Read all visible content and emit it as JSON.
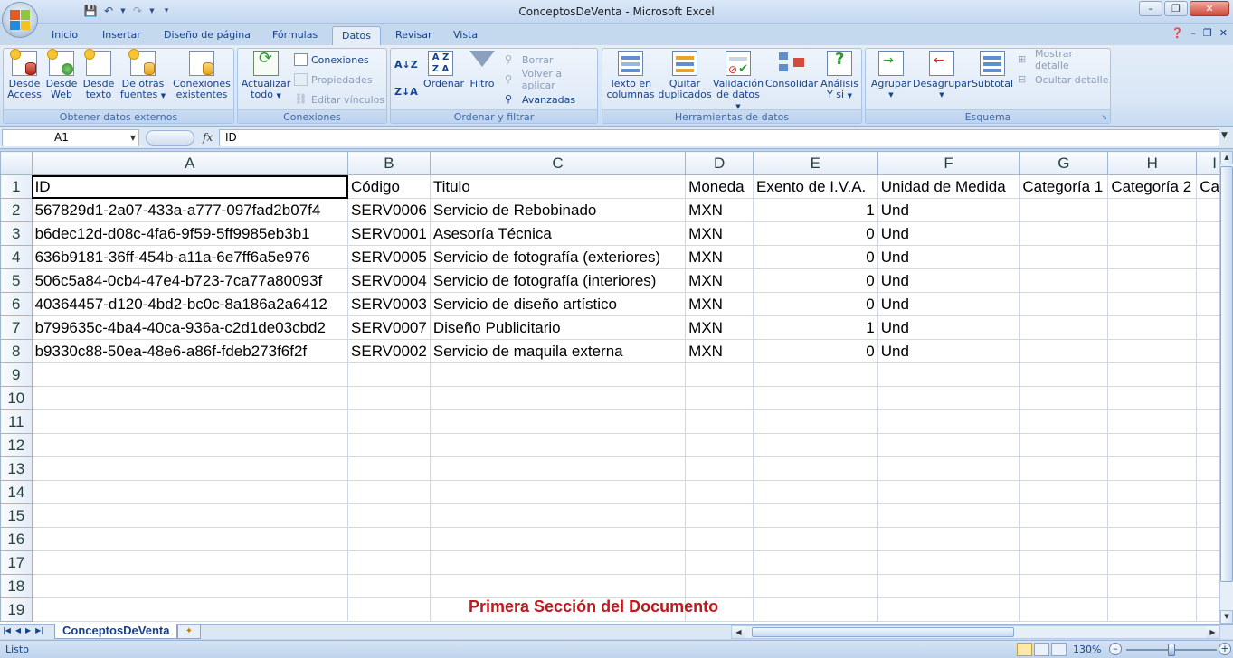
{
  "window": {
    "title": "ConceptosDeVenta - Microsoft Excel",
    "controls": [
      "minimize",
      "restore",
      "close"
    ]
  },
  "ribbon_tabs": [
    {
      "label": "Inicio",
      "active": false
    },
    {
      "label": "Insertar",
      "active": false
    },
    {
      "label": "Diseño de página",
      "active": false
    },
    {
      "label": "Fórmulas",
      "active": false
    },
    {
      "label": "Datos",
      "active": true
    },
    {
      "label": "Revisar",
      "active": false
    },
    {
      "label": "Vista",
      "active": false
    }
  ],
  "ribbon": {
    "obtener": {
      "label": "Obtener datos externos",
      "access": [
        "Desde",
        "Access"
      ],
      "web": [
        "Desde",
        "Web"
      ],
      "texto": [
        "Desde",
        "texto"
      ],
      "otras": [
        "De otras",
        "fuentes"
      ],
      "existentes": [
        "Conexiones",
        "existentes"
      ]
    },
    "conexiones": {
      "label": "Conexiones",
      "actualizar": [
        "Actualizar",
        "todo"
      ],
      "conexiones": "Conexiones",
      "propiedades": "Propiedades",
      "editar": "Editar vínculos"
    },
    "ordenar": {
      "label": "Ordenar y filtrar",
      "ordenar": "Ordenar",
      "filtro": "Filtro",
      "borrar": "Borrar",
      "volver": "Volver a aplicar",
      "avanzadas": "Avanzadas"
    },
    "herramientas": {
      "label": "Herramientas de datos",
      "texto_col": [
        "Texto en",
        "columnas"
      ],
      "quitar": [
        "Quitar",
        "duplicados"
      ],
      "validacion": [
        "Validación",
        "de datos"
      ],
      "consolidar": "Consolidar",
      "analisis": [
        "Análisis",
        "Y si"
      ]
    },
    "esquema": {
      "label": "Esquema",
      "agrupar": "Agrupar",
      "desagrupar": "Desagrupar",
      "subtotal": "Subtotal",
      "mostrar": "Mostrar detalle",
      "ocultar": "Ocultar detalle"
    }
  },
  "formula_bar": {
    "cell_ref": "A1",
    "fx": "fx",
    "value": "ID"
  },
  "sheet": {
    "columns": [
      "A",
      "B",
      "C",
      "D",
      "E",
      "F",
      "G",
      "H",
      "I"
    ],
    "header_row": [
      "ID",
      "Código",
      "Titulo",
      "Moneda",
      "Exento de I.V.A.",
      "Unidad de Medida",
      "Categoría 1",
      "Categoría 2",
      "Ca"
    ],
    "rows": [
      [
        "567829d1-2a07-433a-a777-097fad2b07f4",
        "SERV0006",
        "Servicio de Rebobinado",
        "MXN",
        "1",
        "Und",
        "",
        "",
        ""
      ],
      [
        "b6dec12d-d08c-4fa6-9f59-5ff9985eb3b1",
        "SERV0001",
        "Asesoría Técnica",
        "MXN",
        "0",
        "Und",
        "",
        "",
        ""
      ],
      [
        "636b9181-36ff-454b-a11a-6e7ff6a5e976",
        "SERV0005",
        "Servicio de fotografía (exteriores)",
        "MXN",
        "0",
        "Und",
        "",
        "",
        ""
      ],
      [
        "506c5a84-0cb4-47e4-b723-7ca77a80093f",
        "SERV0004",
        "Servicio de fotografía (interiores)",
        "MXN",
        "0",
        "Und",
        "",
        "",
        ""
      ],
      [
        "40364457-d120-4bd2-bc0c-8a186a2a6412",
        "SERV0003",
        "Servicio de diseño artístico",
        "MXN",
        "0",
        "Und",
        "",
        "",
        ""
      ],
      [
        "b799635c-4ba4-40ca-936a-c2d1de03cbd2",
        "SERV0007",
        "Diseño Publicitario",
        "MXN",
        "1",
        "Und",
        "",
        "",
        ""
      ],
      [
        "b9330c88-50ea-48e6-a86f-fdeb273f6f2f",
        "SERV0002",
        "Servicio de maquila externa",
        "MXN",
        "0",
        "Und",
        "",
        "",
        ""
      ]
    ],
    "row_numbers": [
      "1",
      "2",
      "3",
      "4",
      "5",
      "6",
      "7",
      "8",
      "9",
      "10",
      "11",
      "12",
      "13",
      "14",
      "15",
      "16",
      "17",
      "18",
      "19"
    ],
    "annotation": "Primera Sección del Documento"
  },
  "sheet_tabs": {
    "active": "ConceptosDeVenta"
  },
  "status": {
    "text": "Listo",
    "zoom": "130%"
  }
}
